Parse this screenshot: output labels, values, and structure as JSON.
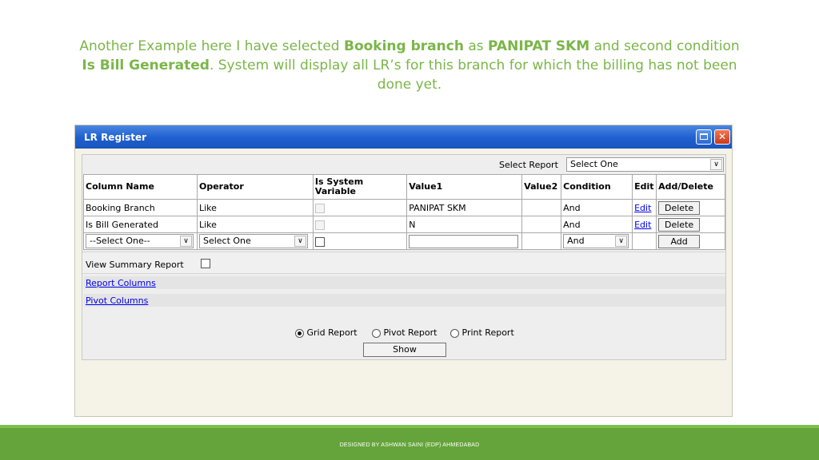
{
  "caption": {
    "p1": "Another Example here I have selected ",
    "b1": "Booking branch",
    "p2": " as ",
    "b2": "PANIPAT SKM",
    "p3": " and second condition ",
    "b3": "Is Bill Generated",
    "p4": ". System will display all LR’s for this branch for which the billing has not been done yet."
  },
  "window": {
    "title": "LR Register"
  },
  "select_report": {
    "label": "Select Report",
    "value": "Select One"
  },
  "grid": {
    "headers": [
      "Column Name",
      "Operator",
      "Is System Variable",
      "Value1",
      "Value2",
      "Condition",
      "Edit",
      "Add/Delete"
    ],
    "rows": [
      {
        "column": "Booking Branch",
        "operator": "Like",
        "value1": "PANIPAT SKM",
        "value2": "",
        "condition": "And",
        "edit": "Edit",
        "action": "Delete"
      },
      {
        "column": "Is Bill Generated",
        "operator": "Like",
        "value1": "N",
        "value2": "",
        "condition": "And",
        "edit": "Edit",
        "action": "Delete"
      }
    ],
    "new_row": {
      "column": "--Select One--",
      "operator": "Select One",
      "condition": "And",
      "action": "Add"
    }
  },
  "summary": {
    "label": "View Summary Report"
  },
  "links": {
    "report_columns": "Report Columns",
    "pivot_columns": "Pivot Columns"
  },
  "report_type": {
    "grid": "Grid Report",
    "pivot": "Pivot Report",
    "print": "Print Report",
    "selected": "grid"
  },
  "show_label": "Show",
  "footer": {
    "text": "DESIGNED BY ASHWAN SAINI (EDP) AHMEDABAD"
  }
}
